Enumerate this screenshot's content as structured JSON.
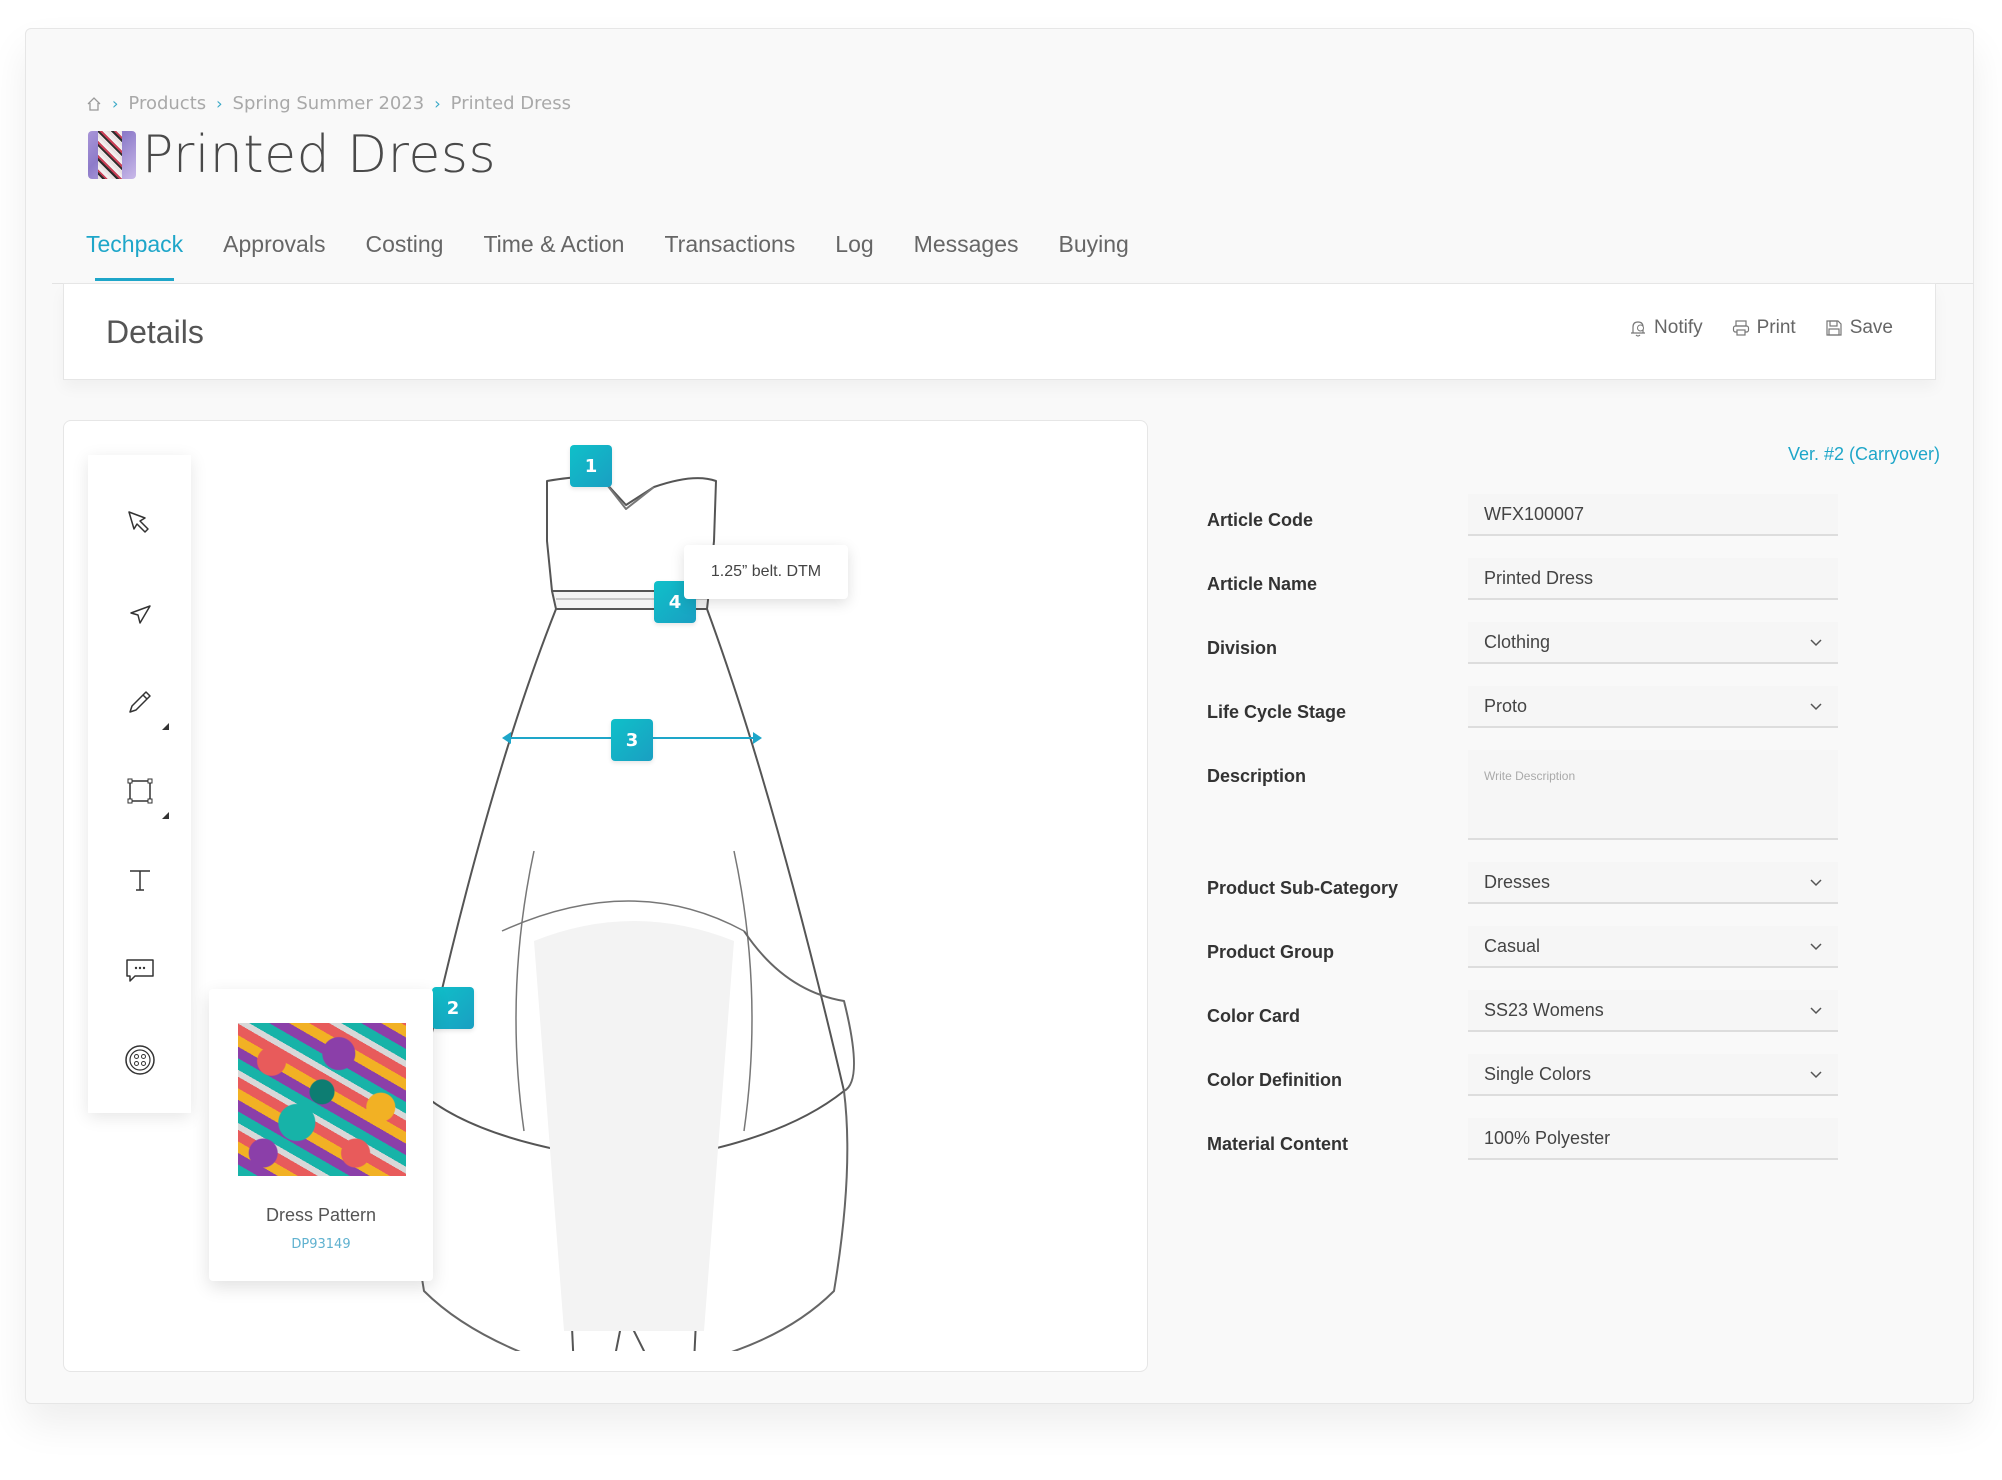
{
  "breadcrumb": {
    "home_icon": "home-icon",
    "items": [
      "Products",
      "Spring Summer 2023",
      "Printed Dress"
    ]
  },
  "page": {
    "title": "Printed Dress",
    "thumbnail": "product-thumbnail"
  },
  "tabs": [
    {
      "label": "Techpack",
      "active": true
    },
    {
      "label": "Approvals"
    },
    {
      "label": "Costing"
    },
    {
      "label": "Time & Action"
    },
    {
      "label": "Transactions"
    },
    {
      "label": "Log"
    },
    {
      "label": "Messages"
    },
    {
      "label": "Buying"
    }
  ],
  "details": {
    "title": "Details",
    "actions": {
      "notify": "Notify",
      "print": "Print",
      "save": "Save"
    }
  },
  "toolbar": {
    "tools": [
      "select-arrow-icon",
      "direct-select-icon",
      "pencil-icon",
      "rectangle-icon",
      "text-icon",
      "comment-icon",
      "button-trim-icon"
    ]
  },
  "canvas": {
    "markers": [
      "1",
      "2",
      "3",
      "4"
    ],
    "tooltip": "1.25” belt. DTM",
    "pattern": {
      "name": "Dress Pattern",
      "code": "DP93149"
    }
  },
  "form": {
    "version": "Ver. #2 (Carryover)",
    "fields": [
      {
        "label": "Article Code",
        "value": "WFX100007",
        "type": "text"
      },
      {
        "label": "Article Name",
        "value": "Printed Dress",
        "type": "text"
      },
      {
        "label": "Division",
        "value": "Clothing",
        "type": "select"
      },
      {
        "label": "Life Cycle Stage",
        "value": "Proto",
        "type": "select"
      },
      {
        "label": "Description",
        "value": "",
        "placeholder": "Write Description",
        "type": "textarea"
      },
      {
        "label": "Product Sub-Category",
        "value": "Dresses",
        "type": "select"
      },
      {
        "label": "Product Group",
        "value": "Casual",
        "type": "select"
      },
      {
        "label": "Color Card",
        "value": "SS23 Womens",
        "type": "select"
      },
      {
        "label": "Color Definition",
        "value": "Single Colors",
        "type": "select"
      },
      {
        "label": "Material Content",
        "value": "100% Polyester",
        "type": "text"
      }
    ]
  },
  "colors": {
    "accent": "#1ea6c9",
    "marker": "#0fc0c9"
  }
}
